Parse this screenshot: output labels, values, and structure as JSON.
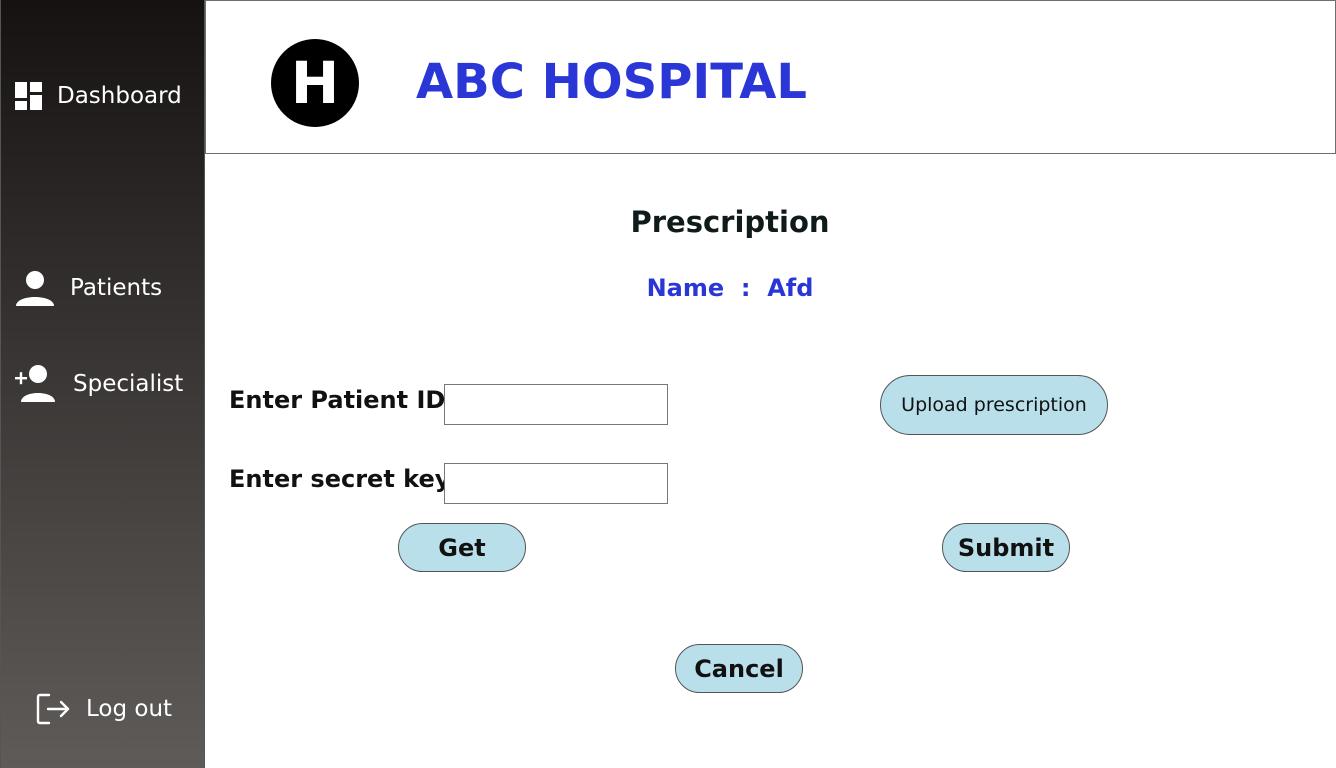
{
  "sidebar": {
    "items": [
      {
        "label": "Dashboard",
        "icon": "dashboard-icon"
      },
      {
        "label": "Patients",
        "icon": "person-icon"
      },
      {
        "label": "Specialist",
        "icon": "add-person-icon"
      }
    ],
    "logout": {
      "label": "Log out",
      "icon": "logout-icon"
    }
  },
  "header": {
    "logo_letter": "H",
    "hospital_name": "ABC HOSPITAL"
  },
  "main": {
    "title": "Prescription",
    "patient_name_label": "Name",
    "patient_name_separator": ":",
    "patient_name_value": "Afd",
    "patient_id_label": "Enter Patient ID",
    "patient_id_value": "",
    "secret_key_label": "Enter secret key",
    "secret_key_value": "",
    "upload_label": "Upload prescription",
    "get_label": "Get",
    "submit_label": "Submit",
    "cancel_label": "Cancel"
  },
  "colors": {
    "accent_blue": "#2a37d6",
    "button_fill": "#b9e0ea",
    "sidebar_top": "#151211",
    "sidebar_bottom": "#5f5b59"
  }
}
